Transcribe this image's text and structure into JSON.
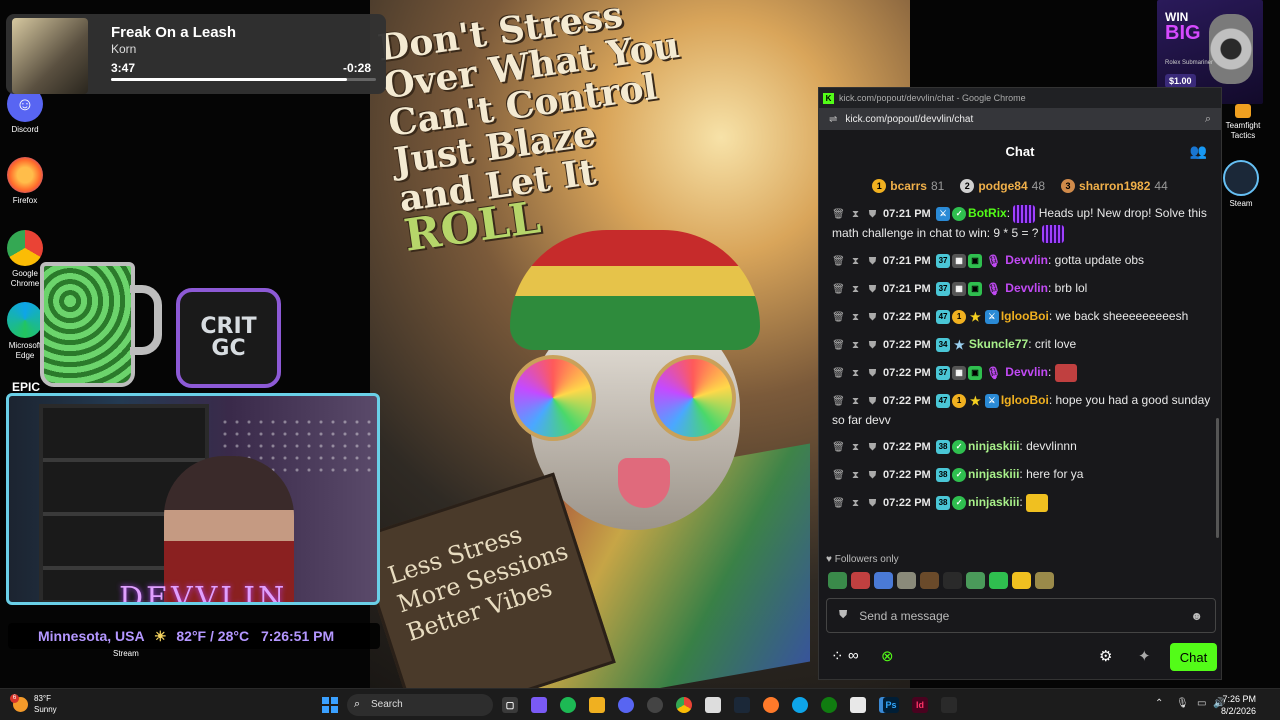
{
  "media": {
    "title": "Freak On a Leash",
    "artist": "Korn",
    "elapsed": "3:47",
    "remaining": "-0:28",
    "progress": 0.89
  },
  "desktop_icons": [
    {
      "label": "Discord"
    },
    {
      "label": "Firefox"
    },
    {
      "label": "Google Chrome"
    },
    {
      "label": "Microsoft Edge"
    },
    {
      "label": "Teamfight Tactics"
    },
    {
      "label": "Steam"
    }
  ],
  "wallpaper": {
    "title_lines": [
      "Don't Stress",
      "Over What You",
      "Can't Control",
      "Just Blaze",
      "and Let It",
      "ROLL"
    ],
    "sign_lines": [
      "Less Stress",
      "More Sessions",
      "Better Vibes"
    ]
  },
  "overlays": {
    "crit_gc": "CRIT GC",
    "epic": "EPIC",
    "streamer_name": "DEVVLIN",
    "location": "Minnesota, USA",
    "weather": "82°F / 28°C",
    "time": "7:26:51 PM",
    "stream_label": "Stream"
  },
  "ad": {
    "win": "WIN",
    "big": "BIG",
    "sub": "Rolex Submariner",
    "price": "$1.00"
  },
  "browser": {
    "title": "kick.com/popout/devvlin/chat - Google Chrome",
    "url": "kick.com/popout/devvlin/chat"
  },
  "chat": {
    "header": "Chat",
    "leaderboard": [
      {
        "rank": "1",
        "name": "bcarrs",
        "score": "81",
        "color": "#f0b020"
      },
      {
        "rank": "2",
        "name": "podge84",
        "score": "48",
        "color": "#d0d0d0"
      },
      {
        "rank": "3",
        "name": "sharron1982",
        "score": "44",
        "color": "#d08a4a"
      }
    ],
    "messages": [
      {
        "time": "07:21 PM",
        "user": "BotRix",
        "color": "#53fc18",
        "text": "Heads up! New drop! Solve this math challenge in chat to win: 9 * 5 = ?",
        "b1": "",
        "b2": ""
      },
      {
        "time": "07:21 PM",
        "user": "Devvlin",
        "color": "#c24af5",
        "text": "gotta update obs",
        "b1": "37",
        "b2": ""
      },
      {
        "time": "07:21 PM",
        "user": "Devvlin",
        "color": "#c24af5",
        "text": "brb lol",
        "b1": "37",
        "b2": ""
      },
      {
        "time": "07:22 PM",
        "user": "IglooBoi",
        "color": "#f0b020",
        "text": "we back sheeeeeeeeesh",
        "b1": "47",
        "b2": "1"
      },
      {
        "time": "07:22 PM",
        "user": "Skuncle77",
        "color": "#a8f08a",
        "text": "crit love",
        "b1": "34",
        "b2": ""
      },
      {
        "time": "07:22 PM",
        "user": "Devvlin",
        "color": "#c24af5",
        "text": "",
        "b1": "37",
        "b2": ""
      },
      {
        "time": "07:22 PM",
        "user": "IglooBoi",
        "color": "#f0b020",
        "text": "hope you had a good sunday so far devv",
        "b1": "47",
        "b2": "1"
      },
      {
        "time": "07:22 PM",
        "user": "ninjaskiii",
        "color": "#a8f08a",
        "text": "devvlinnn",
        "b1": "38",
        "b2": ""
      },
      {
        "time": "07:22 PM",
        "user": "ninjaskiii",
        "color": "#a8f08a",
        "text": "here for ya",
        "b1": "38",
        "b2": ""
      },
      {
        "time": "07:22 PM",
        "user": "ninjaskiii",
        "color": "#a8f08a",
        "text": "",
        "b1": "38",
        "b2": ""
      }
    ],
    "followers_only": "Followers only",
    "input_placeholder": "Send a message",
    "chat_button": "Chat"
  },
  "taskbar": {
    "weather_temp": "83°F",
    "weather_cond": "Sunny",
    "weather_badge": "6",
    "search_placeholder": "Search",
    "clock_time": "7:26 PM",
    "clock_date": "8/2/2026"
  },
  "colors": {
    "kick_green": "#53fc18",
    "chat_bg": "#18181b",
    "taskbar": "#1c1c1c"
  }
}
